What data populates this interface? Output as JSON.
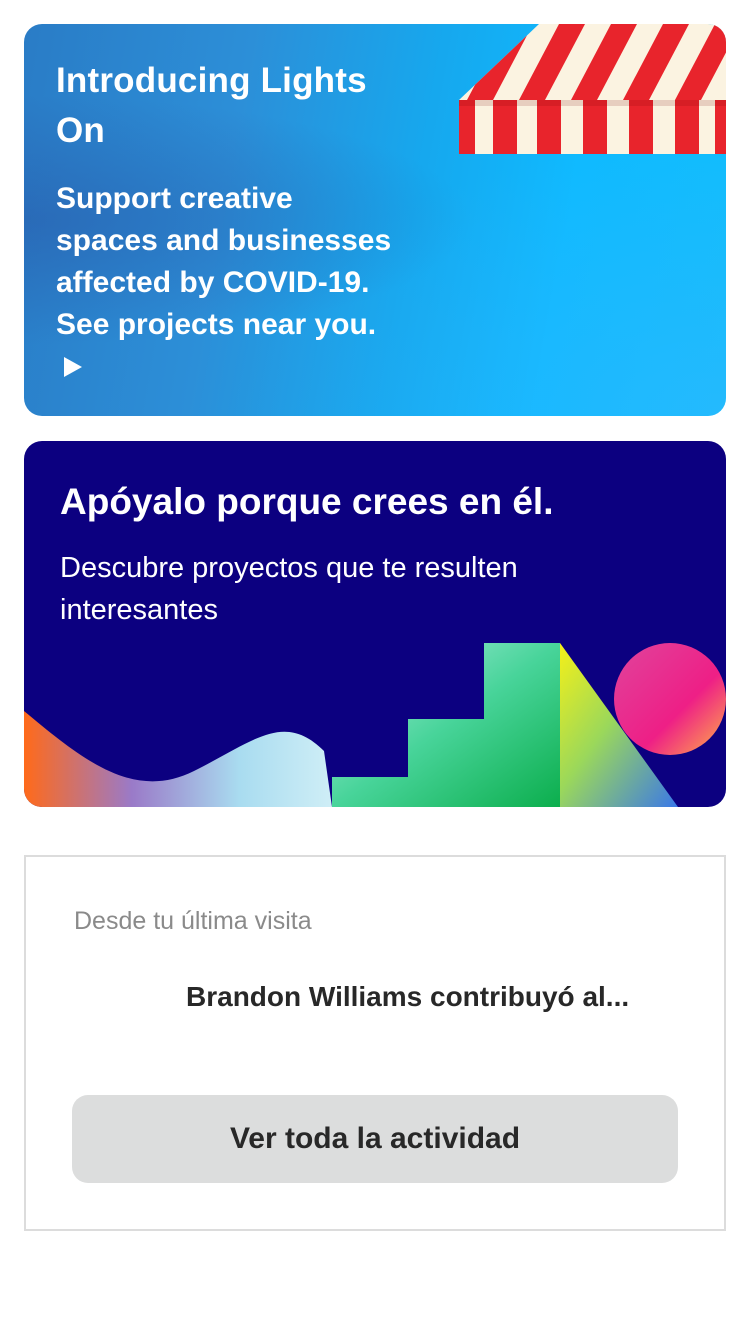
{
  "lights_on": {
    "title": "Introducing Lights On",
    "body": "Support creative spaces and businesses affected by COVID-19. See projects near you.",
    "accent_color": "#12bdfc",
    "awning_colors": [
      "#e8242c",
      "#fbf3e1"
    ]
  },
  "discover": {
    "title": "Apóyalo porque crees en él.",
    "body": "Descubre proyectos que te resulten interesantes",
    "background_color": "#0c0080"
  },
  "activity": {
    "label": "Desde tu última visita",
    "entry": "Brandon Williams contribuyó al...",
    "button_label": "Ver toda la actividad"
  }
}
